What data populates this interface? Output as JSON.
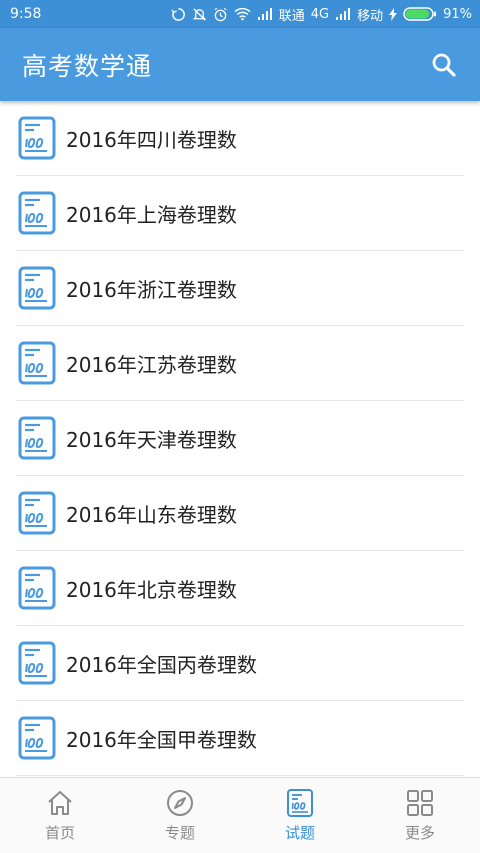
{
  "status_bar": {
    "time": "9:58",
    "carrier1": "联通",
    "network": "4G",
    "carrier2": "移动",
    "battery": "91%",
    "battery_level": 0.91
  },
  "app_bar": {
    "title": "高考数学通",
    "search_icon": "search-icon"
  },
  "list": {
    "item_icon": "exam-doc-icon",
    "items": [
      {
        "label": "2016年四川卷理数"
      },
      {
        "label": "2016年上海卷理数"
      },
      {
        "label": "2016年浙江卷理数"
      },
      {
        "label": "2016年江苏卷理数"
      },
      {
        "label": "2016年天津卷理数"
      },
      {
        "label": "2016年山东卷理数"
      },
      {
        "label": "2016年北京卷理数"
      },
      {
        "label": "2016年全国丙卷理数"
      },
      {
        "label": "2016年全国甲卷理数"
      }
    ]
  },
  "bottom_nav": {
    "items": [
      {
        "label": "首页",
        "icon": "home-icon",
        "active": false
      },
      {
        "label": "专题",
        "icon": "compass-icon",
        "active": false
      },
      {
        "label": "试题",
        "icon": "exam-paper-icon",
        "active": true
      },
      {
        "label": "更多",
        "icon": "grid-icon",
        "active": false
      }
    ]
  },
  "colors": {
    "primary": "#4a9ae0",
    "status_bar": "#3d8fd6",
    "battery_fill": "#4cd964",
    "inactive": "#8a8a8a"
  }
}
